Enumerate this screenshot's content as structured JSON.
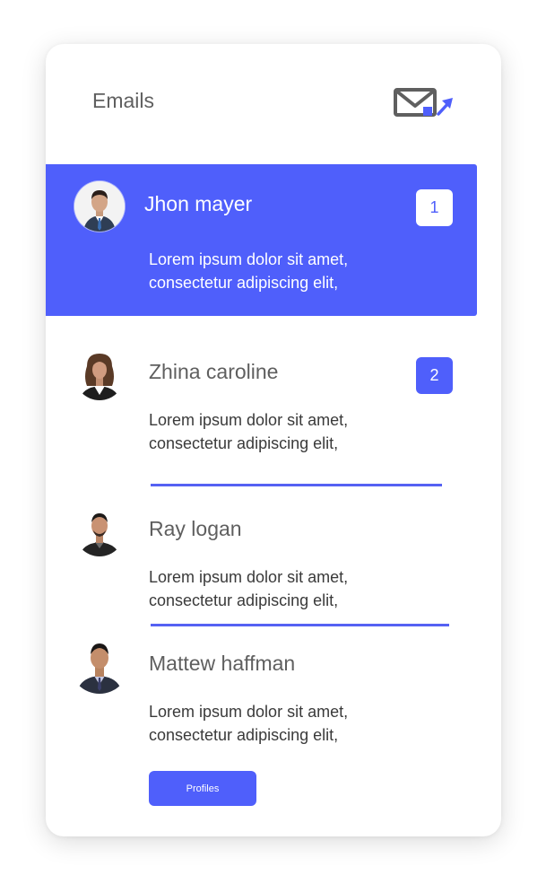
{
  "header": {
    "title": "Emails",
    "icon": "mail-send-icon"
  },
  "colors": {
    "accent": "#4f5ffb",
    "text": "#5f5f5f",
    "card_bg": "#ffffff"
  },
  "emails": [
    {
      "sender": "Jhon mayer",
      "preview_line1": "Lorem ipsum dolor sit amet,",
      "preview_line2": "consectetur adipiscing elit,",
      "badge": "1",
      "selected": true
    },
    {
      "sender": "Zhina caroline",
      "preview_line1": "Lorem ipsum dolor sit amet,",
      "preview_line2": "consectetur adipiscing elit,",
      "badge": "2",
      "selected": false
    },
    {
      "sender": "Ray logan",
      "preview_line1": "Lorem ipsum dolor sit amet,",
      "preview_line2": "consectetur adipiscing elit,",
      "selected": false
    },
    {
      "sender": "Mattew haffman",
      "preview_line1": "Lorem ipsum dolor sit amet,",
      "preview_line2": "consectetur adipiscing elit,",
      "selected": false
    }
  ],
  "footer": {
    "profiles_label": "Profiles"
  }
}
